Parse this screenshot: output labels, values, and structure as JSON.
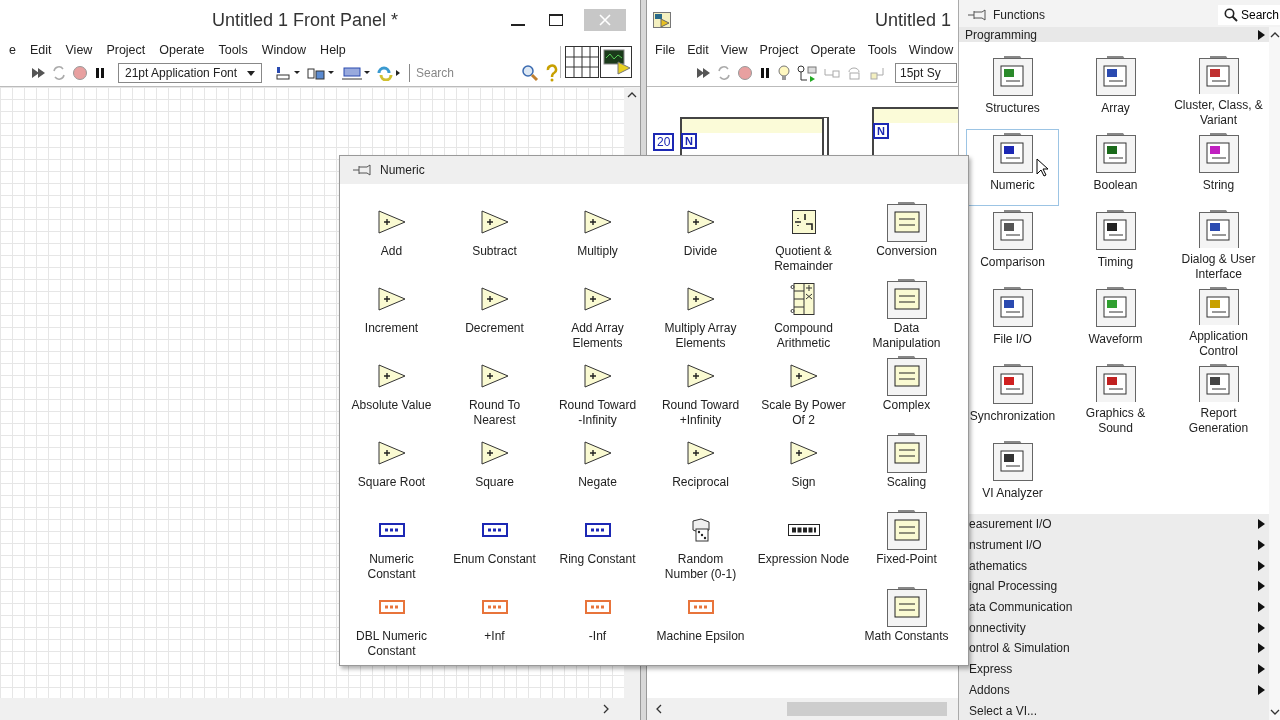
{
  "front_panel": {
    "title": "Untitled 1 Front Panel *",
    "menu": [
      "e",
      "Edit",
      "View",
      "Project",
      "Operate",
      "Tools",
      "Window",
      "Help"
    ],
    "font_selector": "21pt Application Font",
    "search": {
      "placeholder": "Search"
    }
  },
  "block_diagram": {
    "title": "Untitled 1",
    "menu": [
      "File",
      "Edit",
      "View",
      "Project",
      "Operate",
      "Tools",
      "Window"
    ],
    "font_selector": "15pt Sy",
    "count_constant": "20",
    "loop_terminals": [
      "N",
      "N"
    ]
  },
  "functions_palette": {
    "title": "Functions",
    "search_button": "Search",
    "section": "Programming",
    "items": [
      {
        "label": "Structures",
        "selected": false
      },
      {
        "label": "Array",
        "selected": false
      },
      {
        "label": "Cluster, Class, &\nVariant",
        "selected": false
      },
      {
        "label": "Numeric",
        "selected": true
      },
      {
        "label": "Boolean",
        "selected": false
      },
      {
        "label": "String",
        "selected": false
      },
      {
        "label": "Comparison",
        "selected": false
      },
      {
        "label": "Timing",
        "selected": false
      },
      {
        "label": "Dialog & User\nInterface",
        "selected": false
      },
      {
        "label": "File I/O",
        "selected": false
      },
      {
        "label": "Waveform",
        "selected": false
      },
      {
        "label": "Application\nControl",
        "selected": false
      },
      {
        "label": "Synchronization",
        "selected": false
      },
      {
        "label": "Graphics &\nSound",
        "selected": false
      },
      {
        "label": "Report\nGeneration",
        "selected": false
      },
      {
        "label": "VI Analyzer",
        "selected": false
      }
    ],
    "categories": [
      {
        "label": "easurement I/O",
        "submenu": true
      },
      {
        "label": "nstrument I/O",
        "submenu": true
      },
      {
        "label": "athematics",
        "submenu": true
      },
      {
        "label": "ignal Processing",
        "submenu": true
      },
      {
        "label": "ata Communication",
        "submenu": true
      },
      {
        "label": "onnectivity",
        "submenu": true
      },
      {
        "label": "ontrol & Simulation",
        "submenu": true
      },
      {
        "label": "Express",
        "submenu": true
      },
      {
        "label": "Addons",
        "submenu": true
      },
      {
        "label": "Select a VI...",
        "submenu": false
      }
    ]
  },
  "numeric_palette": {
    "title": "Numeric",
    "items": [
      {
        "label": "Add",
        "kind": "node"
      },
      {
        "label": "Subtract",
        "kind": "node"
      },
      {
        "label": "Multiply",
        "kind": "node"
      },
      {
        "label": "Divide",
        "kind": "node"
      },
      {
        "label": "Quotient &\nRemainder",
        "kind": "quotient"
      },
      {
        "label": "Conversion",
        "kind": "folder"
      },
      {
        "label": "Increment",
        "kind": "node"
      },
      {
        "label": "Decrement",
        "kind": "node"
      },
      {
        "label": "Add Array\nElements",
        "kind": "node"
      },
      {
        "label": "Multiply Array\nElements",
        "kind": "node"
      },
      {
        "label": "Compound\nArithmetic",
        "kind": "compound"
      },
      {
        "label": "Data\nManipulation",
        "kind": "folder"
      },
      {
        "label": "Absolute Value",
        "kind": "node"
      },
      {
        "label": "Round To\nNearest",
        "kind": "node"
      },
      {
        "label": "Round Toward\n-Infinity",
        "kind": "node"
      },
      {
        "label": "Round Toward\n+Infinity",
        "kind": "node"
      },
      {
        "label": "Scale By Power\nOf 2",
        "kind": "node"
      },
      {
        "label": "Complex",
        "kind": "folder"
      },
      {
        "label": "Square Root",
        "kind": "node"
      },
      {
        "label": "Square",
        "kind": "node"
      },
      {
        "label": "Negate",
        "kind": "node"
      },
      {
        "label": "Reciprocal",
        "kind": "node"
      },
      {
        "label": "Sign",
        "kind": "node"
      },
      {
        "label": "Scaling",
        "kind": "folder"
      },
      {
        "label": "Numeric\nConstant",
        "kind": "constant",
        "color": "#1c28b4"
      },
      {
        "label": "Enum Constant",
        "kind": "constant",
        "color": "#1c28b4"
      },
      {
        "label": "Ring Constant",
        "kind": "constant",
        "color": "#1c28b4"
      },
      {
        "label": "Random\nNumber (0-1)",
        "kind": "dice"
      },
      {
        "label": "Expression Node",
        "kind": "expression"
      },
      {
        "label": "Fixed-Point",
        "kind": "folder"
      },
      {
        "label": "DBL Numeric\nConstant",
        "kind": "constant",
        "color": "#e8743b"
      },
      {
        "label": "+Inf",
        "kind": "constant",
        "color": "#e8743b"
      },
      {
        "label": "-Inf",
        "kind": "constant",
        "color": "#e8743b"
      },
      {
        "label": "Machine Epsilon",
        "kind": "constant",
        "color": "#e8743b"
      },
      {
        "label": "Math Constants",
        "kind": "folder"
      }
    ]
  }
}
